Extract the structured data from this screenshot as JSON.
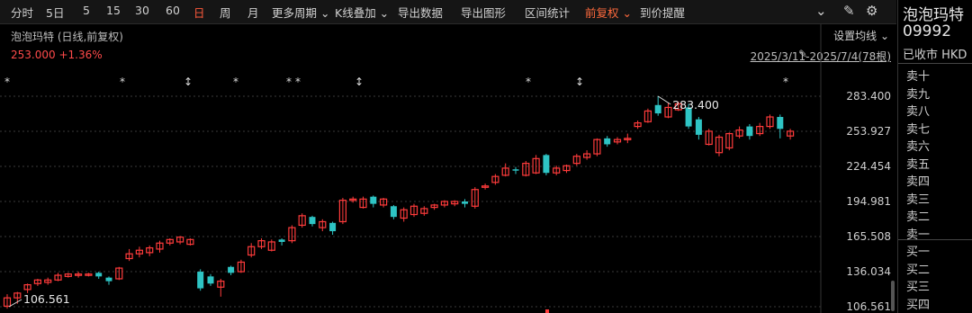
{
  "toolbar": {
    "items": [
      "分时",
      "5日",
      "5",
      "15",
      "30",
      "60",
      "日",
      "周",
      "月",
      "更多周期",
      "K线叠加",
      "导出数据",
      "导出图形",
      "区间统计",
      "前复权",
      "到价提醒"
    ],
    "dropdowns": [
      "更多周期",
      "K线叠加",
      "前复权"
    ],
    "active": "日",
    "icons": [
      "chevron-circle-icon",
      "brush-icon",
      "settings-icon"
    ]
  },
  "chart": {
    "info_name": "泡泡玛特 (日线,前复权)",
    "info_change": "253.000 +1.36%",
    "setting_label": "设置均线",
    "range_label": "2025/3/11-2025/7/4(78根)",
    "high_label": "283.400",
    "low_label": "106.561",
    "colors": {
      "up": "#ff3b3b",
      "down": "#2ec4c4"
    },
    "event_markers": [
      "*",
      "*",
      "↕",
      "*",
      "*",
      "*",
      "↕",
      "*",
      "↕",
      "*",
      "*"
    ]
  },
  "chart_data": {
    "type": "candlestick",
    "y_ticks": [
      "283.400",
      "253.927",
      "224.454",
      "194.981",
      "165.508",
      "136.034",
      "106.561"
    ],
    "y_range": [
      106.561,
      283.4
    ],
    "candles": [
      {
        "o": 107,
        "c": 114,
        "h": 117,
        "l": 105,
        "d": "up"
      },
      {
        "o": 114,
        "c": 118,
        "h": 119,
        "l": 109,
        "d": "up"
      },
      {
        "o": 121,
        "c": 125,
        "h": 126,
        "l": 118,
        "d": "up"
      },
      {
        "o": 126,
        "c": 129,
        "h": 130,
        "l": 124,
        "d": "up"
      },
      {
        "o": 127,
        "c": 129,
        "h": 131,
        "l": 125,
        "d": "up"
      },
      {
        "o": 129,
        "c": 133,
        "h": 135,
        "l": 128,
        "d": "up"
      },
      {
        "o": 132,
        "c": 134,
        "h": 135,
        "l": 131,
        "d": "up"
      },
      {
        "o": 133,
        "c": 134,
        "h": 136,
        "l": 131,
        "d": "up"
      },
      {
        "o": 133,
        "c": 134,
        "h": 135,
        "l": 132,
        "d": "up"
      },
      {
        "o": 135,
        "c": 132,
        "h": 136,
        "l": 130,
        "d": "down"
      },
      {
        "o": 131,
        "c": 128,
        "h": 132,
        "l": 125,
        "d": "down"
      },
      {
        "o": 130,
        "c": 139,
        "h": 140,
        "l": 129,
        "d": "up"
      },
      {
        "o": 147,
        "c": 151,
        "h": 155,
        "l": 145,
        "d": "up"
      },
      {
        "o": 151,
        "c": 154,
        "h": 157,
        "l": 148,
        "d": "up"
      },
      {
        "o": 152,
        "c": 156,
        "h": 158,
        "l": 149,
        "d": "up"
      },
      {
        "o": 155,
        "c": 160,
        "h": 162,
        "l": 152,
        "d": "up"
      },
      {
        "o": 160,
        "c": 163,
        "h": 164,
        "l": 158,
        "d": "up"
      },
      {
        "o": 161,
        "c": 165,
        "h": 166,
        "l": 159,
        "d": "up"
      },
      {
        "o": 159,
        "c": 163,
        "h": 164,
        "l": 158,
        "d": "up"
      },
      {
        "o": 136,
        "c": 122,
        "h": 138,
        "l": 120,
        "d": "down"
      },
      {
        "o": 132,
        "c": 126,
        "h": 134,
        "l": 124,
        "d": "down"
      },
      {
        "o": 123,
        "c": 128,
        "h": 130,
        "l": 115,
        "d": "up"
      },
      {
        "o": 140,
        "c": 135,
        "h": 141,
        "l": 133,
        "d": "down"
      },
      {
        "o": 136,
        "c": 144,
        "h": 146,
        "l": 135,
        "d": "up"
      },
      {
        "o": 150,
        "c": 157,
        "h": 160,
        "l": 148,
        "d": "up"
      },
      {
        "o": 157,
        "c": 162,
        "h": 164,
        "l": 155,
        "d": "up"
      },
      {
        "o": 154,
        "c": 161,
        "h": 163,
        "l": 153,
        "d": "up"
      },
      {
        "o": 163,
        "c": 161,
        "h": 164,
        "l": 158,
        "d": "down"
      },
      {
        "o": 162,
        "c": 173,
        "h": 175,
        "l": 160,
        "d": "up"
      },
      {
        "o": 175,
        "c": 183,
        "h": 185,
        "l": 173,
        "d": "up"
      },
      {
        "o": 182,
        "c": 176,
        "h": 183,
        "l": 174,
        "d": "down"
      },
      {
        "o": 173,
        "c": 178,
        "h": 180,
        "l": 170,
        "d": "up"
      },
      {
        "o": 177,
        "c": 170,
        "h": 178,
        "l": 167,
        "d": "down"
      },
      {
        "o": 178,
        "c": 196,
        "h": 198,
        "l": 176,
        "d": "up"
      },
      {
        "o": 196,
        "c": 197,
        "h": 199,
        "l": 194,
        "d": "up"
      },
      {
        "o": 190,
        "c": 197,
        "h": 199,
        "l": 189,
        "d": "up"
      },
      {
        "o": 199,
        "c": 193,
        "h": 200,
        "l": 190,
        "d": "down"
      },
      {
        "o": 192,
        "c": 197,
        "h": 198,
        "l": 190,
        "d": "up"
      },
      {
        "o": 191,
        "c": 182,
        "h": 192,
        "l": 180,
        "d": "down"
      },
      {
        "o": 181,
        "c": 188,
        "h": 190,
        "l": 178,
        "d": "up"
      },
      {
        "o": 184,
        "c": 191,
        "h": 193,
        "l": 182,
        "d": "up"
      },
      {
        "o": 185,
        "c": 189,
        "h": 191,
        "l": 183,
        "d": "up"
      },
      {
        "o": 190,
        "c": 192,
        "h": 193,
        "l": 188,
        "d": "up"
      },
      {
        "o": 192,
        "c": 195,
        "h": 196,
        "l": 190,
        "d": "up"
      },
      {
        "o": 193,
        "c": 195,
        "h": 196,
        "l": 191,
        "d": "up"
      },
      {
        "o": 195,
        "c": 193,
        "h": 197,
        "l": 190,
        "d": "down"
      },
      {
        "o": 191,
        "c": 205,
        "h": 207,
        "l": 189,
        "d": "up"
      },
      {
        "o": 207,
        "c": 208,
        "h": 210,
        "l": 205,
        "d": "up"
      },
      {
        "o": 211,
        "c": 216,
        "h": 218,
        "l": 209,
        "d": "up"
      },
      {
        "o": 217,
        "c": 223,
        "h": 227,
        "l": 216,
        "d": "up"
      },
      {
        "o": 222,
        "c": 221,
        "h": 224,
        "l": 218,
        "d": "down"
      },
      {
        "o": 217,
        "c": 227,
        "h": 229,
        "l": 216,
        "d": "up"
      },
      {
        "o": 219,
        "c": 231,
        "h": 234,
        "l": 218,
        "d": "up"
      },
      {
        "o": 234,
        "c": 219,
        "h": 235,
        "l": 217,
        "d": "down"
      },
      {
        "o": 219,
        "c": 223,
        "h": 225,
        "l": 217,
        "d": "up"
      },
      {
        "o": 221,
        "c": 225,
        "h": 226,
        "l": 219,
        "d": "up"
      },
      {
        "o": 227,
        "c": 233,
        "h": 235,
        "l": 225,
        "d": "up"
      },
      {
        "o": 232,
        "c": 235,
        "h": 238,
        "l": 230,
        "d": "up"
      },
      {
        "o": 235,
        "c": 247,
        "h": 248,
        "l": 233,
        "d": "up"
      },
      {
        "o": 248,
        "c": 243,
        "h": 250,
        "l": 241,
        "d": "down"
      },
      {
        "o": 245,
        "c": 247,
        "h": 249,
        "l": 243,
        "d": "up"
      },
      {
        "o": 247,
        "c": 248,
        "h": 252,
        "l": 244,
        "d": "up"
      },
      {
        "o": 258,
        "c": 261,
        "h": 263,
        "l": 256,
        "d": "up"
      },
      {
        "o": 262,
        "c": 271,
        "h": 273,
        "l": 261,
        "d": "up"
      },
      {
        "o": 276,
        "c": 269,
        "h": 283.4,
        "l": 267,
        "d": "down"
      },
      {
        "o": 266,
        "c": 274,
        "h": 278,
        "l": 265,
        "d": "up"
      },
      {
        "o": 272,
        "c": 277,
        "h": 279,
        "l": 271,
        "d": "up"
      },
      {
        "o": 274,
        "c": 258,
        "h": 277,
        "l": 256,
        "d": "down"
      },
      {
        "o": 264,
        "c": 251,
        "h": 266,
        "l": 247,
        "d": "down"
      },
      {
        "o": 243,
        "c": 254,
        "h": 256,
        "l": 242,
        "d": "up"
      },
      {
        "o": 236,
        "c": 249,
        "h": 251,
        "l": 233,
        "d": "up"
      },
      {
        "o": 240,
        "c": 252,
        "h": 253,
        "l": 238,
        "d": "up"
      },
      {
        "o": 250,
        "c": 255,
        "h": 258,
        "l": 248,
        "d": "up"
      },
      {
        "o": 258,
        "c": 250,
        "h": 260,
        "l": 247,
        "d": "down"
      },
      {
        "o": 252,
        "c": 258,
        "h": 261,
        "l": 250,
        "d": "up"
      },
      {
        "o": 258,
        "c": 266,
        "h": 268,
        "l": 256,
        "d": "up"
      },
      {
        "o": 266,
        "c": 256,
        "h": 268,
        "l": 248,
        "d": "down"
      },
      {
        "o": 250,
        "c": 254,
        "h": 256,
        "l": 247,
        "d": "up"
      }
    ]
  },
  "side": {
    "name": "泡泡玛特",
    "code": "09992",
    "status": "已收市 HKD",
    "sell": [
      "卖十",
      "卖九",
      "卖八",
      "卖七",
      "卖六",
      "卖五",
      "卖四",
      "卖三",
      "卖二",
      "卖一"
    ],
    "buy": [
      "买一",
      "买二",
      "买三",
      "买四"
    ]
  }
}
